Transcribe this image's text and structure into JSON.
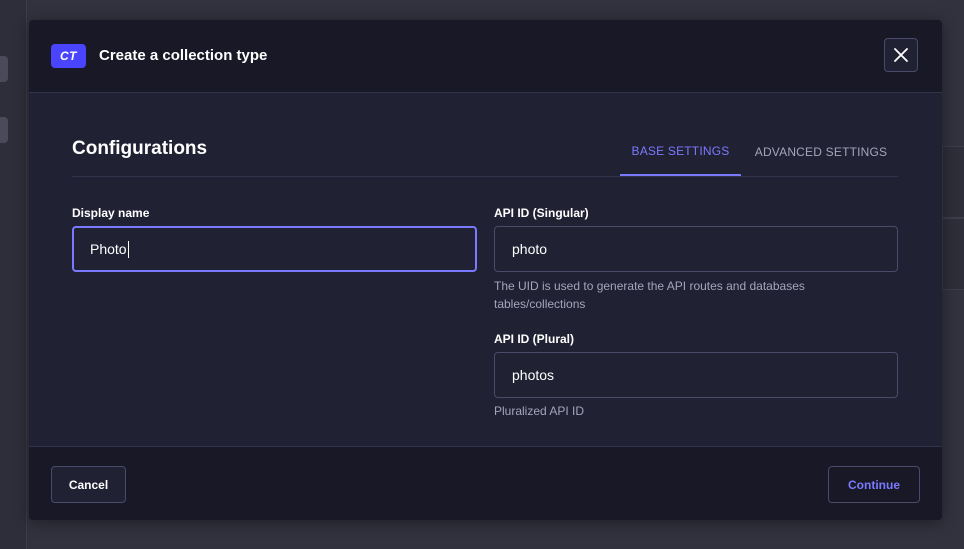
{
  "modal": {
    "badge": "CT",
    "title": "Create a collection type",
    "close_icon": "close-icon"
  },
  "configurations": {
    "title": "Configurations",
    "tabs": [
      {
        "label": "BASE SETTINGS",
        "active": true
      },
      {
        "label": "ADVANCED SETTINGS",
        "active": false
      }
    ]
  },
  "form": {
    "display_name": {
      "label": "Display name",
      "value": "Photo"
    },
    "api_singular": {
      "label": "API ID (Singular)",
      "value": "photo",
      "hint": "The UID is used to generate the API routes and databases tables/collections"
    },
    "api_plural": {
      "label": "API ID (Plural)",
      "value": "photos",
      "hint": "Pluralized API ID"
    }
  },
  "footer": {
    "cancel_label": "Cancel",
    "continue_label": "Continue"
  },
  "colors": {
    "accent": "#7b79ff",
    "badge": "#4945ff",
    "modal_bg": "#212134",
    "header_bg": "#181826"
  }
}
